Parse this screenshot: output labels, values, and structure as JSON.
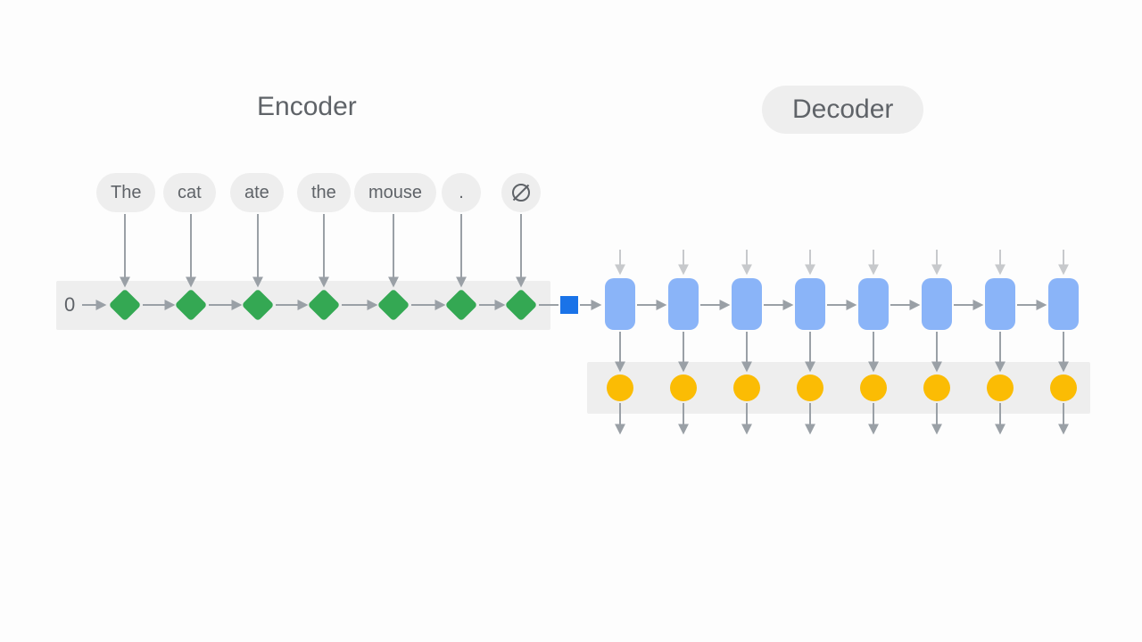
{
  "labels": {
    "encoder": "Encoder",
    "decoder": "Decoder",
    "initial_state": "0"
  },
  "tokens": [
    "The",
    "cat",
    "ate",
    "the",
    "mouse",
    ".",
    "∅"
  ],
  "encoder_steps": 7,
  "decoder_steps": 8,
  "colors": {
    "encoder_node": "#34a853",
    "decoder_cell": "#8ab4f8",
    "context_vector": "#1a73e8",
    "output_node": "#fbbc04",
    "bg_bar": "#eeeeee",
    "text": "#5f6368",
    "arrow": "#9aa0a6",
    "arrow_faint": "#c7c9cc"
  }
}
